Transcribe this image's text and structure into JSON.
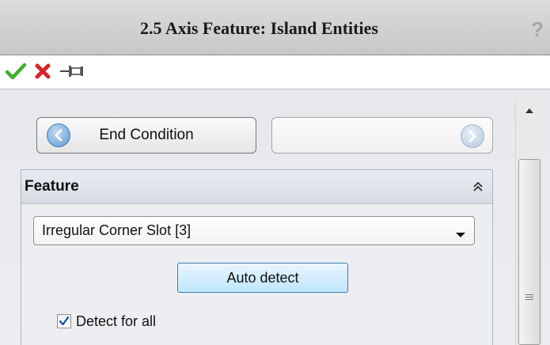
{
  "title": "2.5 Axis Feature: Island Entities",
  "help_glyph": "?",
  "toolbar": {
    "ok_icon": "checkmark-icon",
    "cancel_icon": "red-x-icon",
    "pin_icon": "pushpin-icon"
  },
  "nav": {
    "back_label": "End Condition",
    "back_icon": "back-arrow-icon",
    "next_label": "",
    "next_icon": "next-arrow-icon"
  },
  "feature_group": {
    "title": "Feature",
    "collapse_icon": "double-chevron-up-icon",
    "select_value": "Irregular Corner Slot [3]",
    "auto_detect_label": "Auto detect",
    "detect_all_label": "Detect for all",
    "detect_all_checked": true
  },
  "colors": {
    "ok_green": "#3fae2a",
    "cancel_red": "#d9252a",
    "auto_button": "#bee6fd"
  }
}
